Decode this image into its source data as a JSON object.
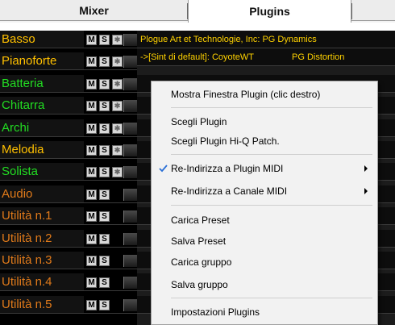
{
  "tabs": [
    {
      "label": "Mixer"
    },
    {
      "label": "Plugins"
    }
  ],
  "buttons": {
    "mute": "M",
    "solo": "S",
    "fx": "✱"
  },
  "tracks": [
    {
      "name": "Basso",
      "color": "#ffc000"
    },
    {
      "name": "Pianoforte",
      "color": "#ffc000"
    },
    {
      "name": "Batteria",
      "color": "#22dd22"
    },
    {
      "name": "Chitarra",
      "color": "#22dd22"
    },
    {
      "name": "Archi",
      "color": "#22dd22"
    },
    {
      "name": "Melodia",
      "color": "#ffc000"
    },
    {
      "name": "Solista",
      "color": "#22dd22"
    },
    {
      "name": "Audio",
      "color": "#e07a1a"
    },
    {
      "name": "Utilità n.1",
      "color": "#e07a1a"
    },
    {
      "name": "Utilità n.2",
      "color": "#e07a1a"
    },
    {
      "name": "Utilità n.3",
      "color": "#e07a1a"
    },
    {
      "name": "Utilità n.4",
      "color": "#e07a1a"
    },
    {
      "name": "Utilità n.5",
      "color": "#e07a1a"
    }
  ],
  "plugins": {
    "row1": "Plogue Art et Technologie, Inc: PG Dynamics",
    "row2_a": "->[Sint di default]: CoyoteWT",
    "row2_b": "PG Distortion"
  },
  "menu": {
    "items": [
      {
        "label": "Mostra Finestra Plugin (clic destro)"
      },
      {
        "label": "Scegli Plugin"
      },
      {
        "label": "Scegli Plugin Hi-Q Patch."
      },
      {
        "label": "Re-Indirizza a Plugin MIDI",
        "checked": true,
        "submenu": true
      },
      {
        "label": "Re-Indirizza a Canale MIDI",
        "submenu": true
      },
      {
        "label": "Carica Preset"
      },
      {
        "label": "Salva Preset"
      },
      {
        "label": "Carica gruppo"
      },
      {
        "label": "Salva gruppo"
      },
      {
        "label": "Impostazioni Plugins"
      }
    ]
  },
  "colors": {
    "check": "#2a6fd6",
    "plugin_text": "#ffd200"
  }
}
